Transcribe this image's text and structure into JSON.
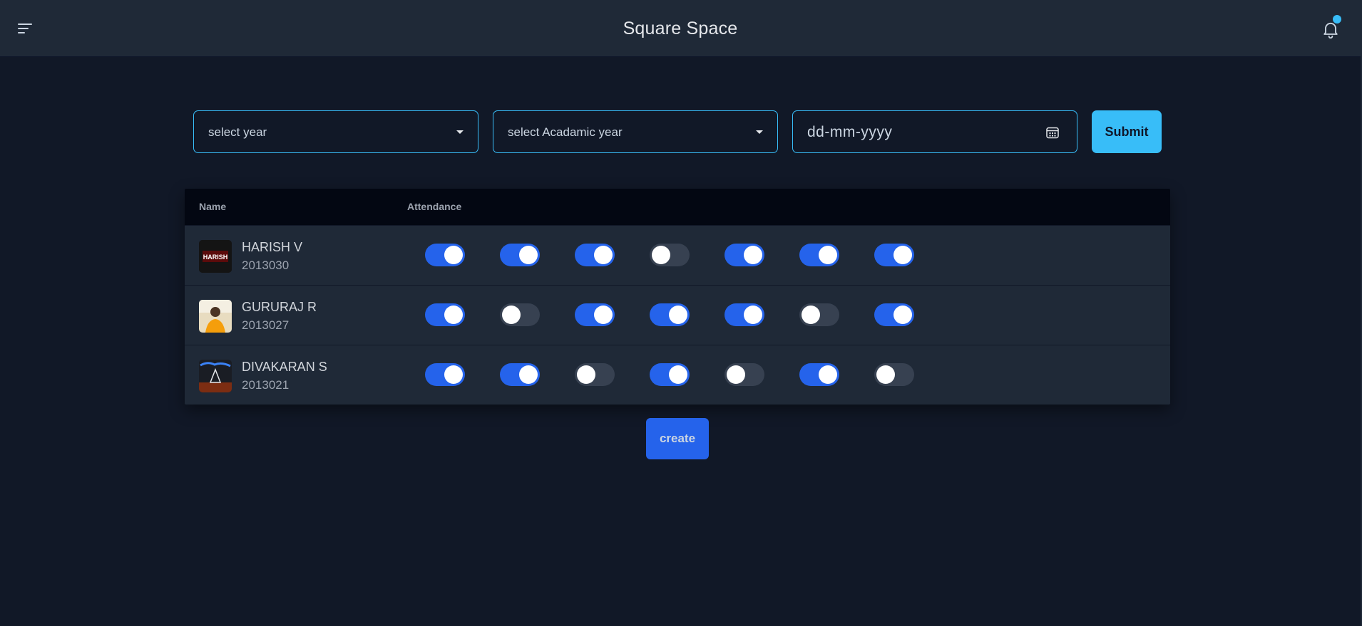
{
  "header": {
    "title": "Square Space",
    "menu_icon": "hamburger-menu-icon",
    "notification_icon": "bell-icon",
    "notification_badge_color": "#38bdf8"
  },
  "filters": {
    "year_select": {
      "value": "select year"
    },
    "academic_year_select": {
      "value": "select Acadamic year"
    },
    "date_input": {
      "placeholder": "dd-mm-yyyy",
      "icon": "calendar-icon"
    },
    "submit_label": "Submit"
  },
  "table": {
    "headers": {
      "name": "Name",
      "attendance": "Attendance"
    },
    "rows": [
      {
        "name": "HARISH V",
        "id": "2013030",
        "avatar_text": "HARISH",
        "attendance": [
          true,
          true,
          true,
          false,
          true,
          true,
          true
        ]
      },
      {
        "name": "GURURAJ R",
        "id": "2013027",
        "avatar_text": "",
        "attendance": [
          true,
          false,
          true,
          true,
          true,
          false,
          true
        ]
      },
      {
        "name": "DIVAKARAN S",
        "id": "2013021",
        "avatar_text": "",
        "attendance": [
          true,
          true,
          false,
          true,
          false,
          true,
          false
        ]
      }
    ]
  },
  "create_label": "create",
  "colors": {
    "background": "#111827",
    "header_bg": "#1f2937",
    "accent": "#38bdf8",
    "toggle_on": "#2563eb",
    "toggle_off": "#374151"
  }
}
